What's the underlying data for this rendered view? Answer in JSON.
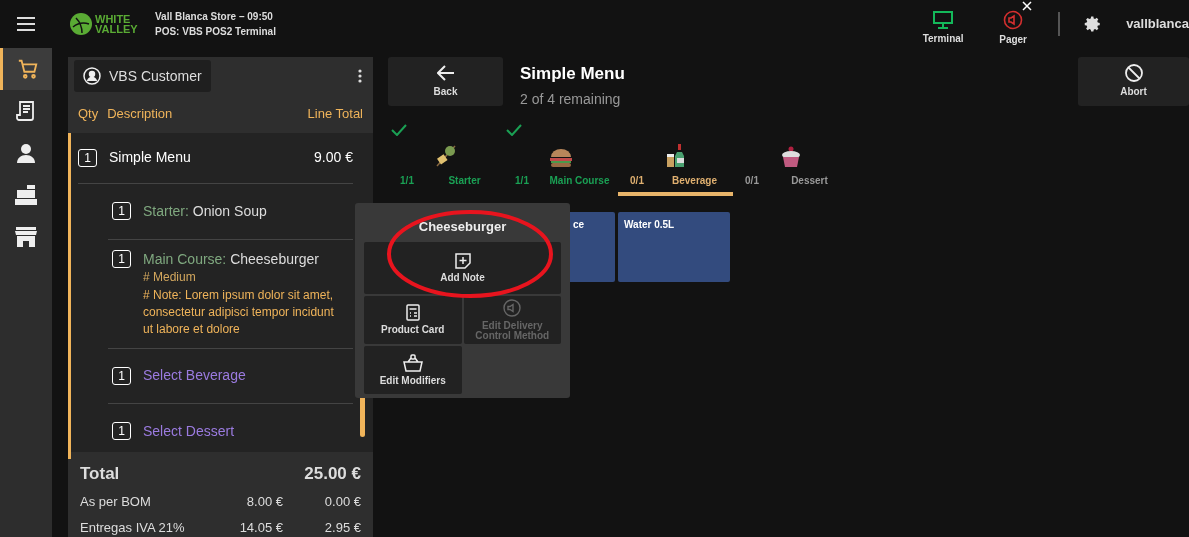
{
  "header": {
    "logo_text": [
      "WHITE",
      "VALLEY"
    ],
    "store": "Vall Blanca Store – 09:50",
    "pos": "POS: VBS POS2 Terminal",
    "devices": [
      {
        "label": "Terminal",
        "kind": "terminal",
        "connected": true
      },
      {
        "label": "Pager",
        "kind": "pager",
        "connected": false
      }
    ],
    "user": "vallblanca"
  },
  "sidebar": {
    "items": [
      {
        "kind": "cart",
        "selected": true
      },
      {
        "kind": "receipt",
        "selected": false
      },
      {
        "kind": "person",
        "selected": false
      },
      {
        "kind": "register",
        "selected": false
      },
      {
        "kind": "store",
        "selected": false
      }
    ]
  },
  "order": {
    "customer": "VBS Customer",
    "columns": [
      "Qty",
      "Description",
      "Line Total"
    ],
    "lines": [
      {
        "qty": "1",
        "description": "Simple Menu",
        "total": "9.00 €",
        "selected": true,
        "children": [
          {
            "kind": "item",
            "qty": "1",
            "course": "Starter:",
            "name": "Onion Soup"
          },
          {
            "kind": "item",
            "qty": "1",
            "course": "Main Course:",
            "name": "Cheeseburger",
            "notes": [
              {
                "kind": "modifier",
                "text": "# Medium"
              },
              {
                "kind": "note",
                "text": "# Note: Lorem ipsum dolor sit amet, consectetur adipisci tempor incidunt ut labore et dolore"
              }
            ]
          },
          {
            "kind": "placeholder",
            "qty": "1",
            "name": "Select Beverage"
          },
          {
            "kind": "placeholder",
            "qty": "1",
            "name": "Select Dessert"
          }
        ]
      }
    ],
    "total_label": "Total",
    "total": "25.00 €",
    "taxes": [
      {
        "label": "As per BOM",
        "base": "8.00 €",
        "tax": "0.00 €"
      },
      {
        "label": "Entregas IVA 21%",
        "base": "14.05 €",
        "tax": "2.95 €"
      }
    ]
  },
  "menu": {
    "back": "Back",
    "title": "Simple Menu",
    "subtitle": "2 of 4 remaining",
    "abort": "Abort",
    "courses": [
      {
        "kind": "starter",
        "count": "1/1",
        "label": "Starter",
        "complete": true,
        "selected": false
      },
      {
        "kind": "burger",
        "count": "1/1",
        "label": "Main Course",
        "complete": true,
        "selected": false
      },
      {
        "kind": "drink",
        "count": "0/1",
        "label": "Beverage",
        "complete": false,
        "selected": true
      },
      {
        "kind": "cupcake",
        "count": "0/1",
        "label": "Dessert",
        "complete": false,
        "selected": false
      }
    ],
    "products": [
      "ce",
      "Water 0.5L"
    ]
  },
  "popup": {
    "title": "Cheeseburger",
    "actions": [
      {
        "kind": "note",
        "label": "Add Note",
        "disabled": false
      },
      {
        "kind": "card",
        "label": "Product Card",
        "disabled": false
      },
      {
        "kind": "delivery",
        "label": "Edit Delivery Control Method",
        "disabled": true
      },
      {
        "kind": "basket",
        "label": "Edit Modifiers",
        "disabled": false
      }
    ]
  }
}
